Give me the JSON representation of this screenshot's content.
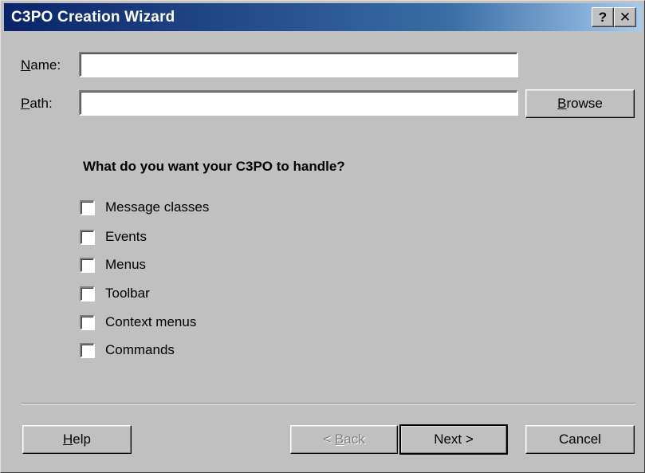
{
  "window": {
    "title": "C3PO Creation Wizard",
    "help_glyph": "?",
    "close_glyph": "✕"
  },
  "form": {
    "name": {
      "label_key": "N",
      "label_rest": "ame:",
      "value": ""
    },
    "path": {
      "label_key": "P",
      "label_rest": "ath:",
      "value": ""
    },
    "browse": {
      "key": "B",
      "rest": "rowse"
    }
  },
  "question": "What do you want your C3PO to handle?",
  "options": [
    {
      "label": "Message classes",
      "checked": false
    },
    {
      "label": "Events",
      "checked": false
    },
    {
      "label": "Menus",
      "checked": false
    },
    {
      "label": "Toolbar",
      "checked": false
    },
    {
      "label": "Context menus",
      "checked": false
    },
    {
      "label": "Commands",
      "checked": false
    }
  ],
  "buttons": {
    "help": {
      "key": "H",
      "rest": "elp"
    },
    "back": {
      "prefix": "< ",
      "key": "B",
      "rest": "ack",
      "enabled": false
    },
    "next": {
      "label": "Next >"
    },
    "cancel": {
      "label": "Cancel"
    }
  }
}
